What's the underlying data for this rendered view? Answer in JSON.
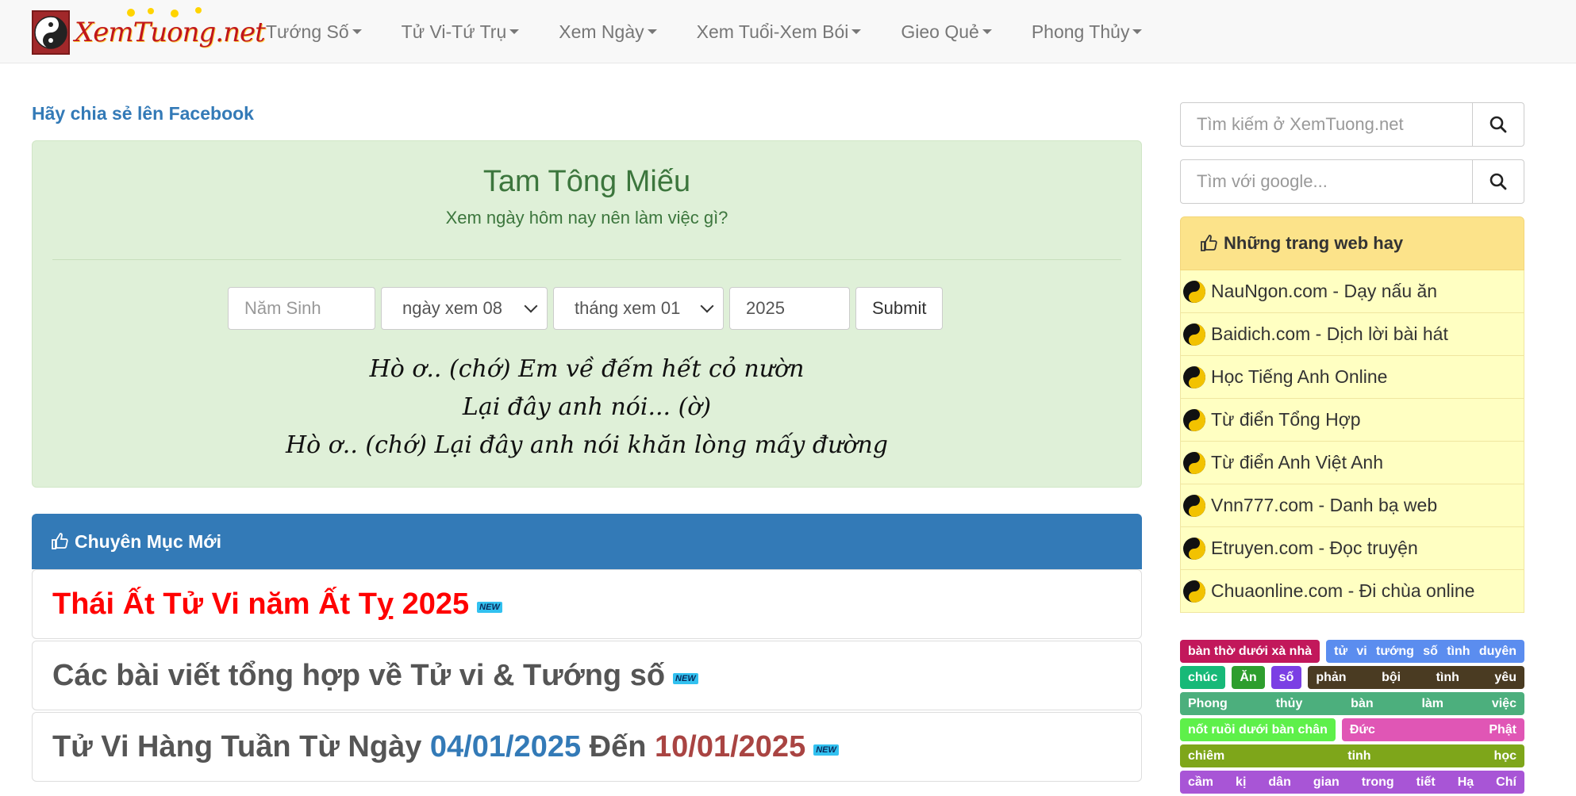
{
  "brand": {
    "logo_text": "XemTuong.net"
  },
  "nav": [
    {
      "label": "Tướng Số"
    },
    {
      "label": "Tử Vi-Tứ Trụ"
    },
    {
      "label": "Xem Ngày"
    },
    {
      "label": "Xem Tuổi-Xem Bói"
    },
    {
      "label": "Gieo Quẻ"
    },
    {
      "label": "Phong Thủy"
    }
  ],
  "share_link": "Hãy chia sẻ lên Facebook",
  "hero": {
    "title": "Tam Tông Miếu",
    "subtitle": "Xem ngày hôm nay nên làm việc gì?",
    "form": {
      "birth_year_placeholder": "Năm Sinh",
      "day_select": "ngày xem 08",
      "month_select": "tháng xem 01",
      "year_value": "2025",
      "submit_label": "Submit"
    },
    "poem": [
      "Hò ơ.. (chớ) Em về đếm hết cỏ nườn",
      "Lại đây anh nói... (ờ)",
      "Hò ơ.. (chớ) Lại đây anh nói khăn lòng mấy đường"
    ]
  },
  "new_section": {
    "header": "Chuyên Mục Mới",
    "badge": "NEW",
    "items": [
      {
        "text": "Thái Ất Tử Vi năm Ất Tỵ 2025"
      },
      {
        "text": "Các bài viết tổng hợp về Tử vi & Tướng số"
      },
      {
        "prefix": "Tử Vi Hàng Tuần Từ Ngày",
        "date1": "04/01/2025",
        "mid": "Đến",
        "date2": "10/01/2025"
      }
    ]
  },
  "sidebar": {
    "search_placeholder": "Tìm kiếm ở XemTuong.net",
    "google_placeholder": "Tìm với google...",
    "links_header": "Những trang web hay",
    "links": [
      "NauNgon.com - Dạy nấu ăn",
      "Baidich.com - Dịch lời bài hát",
      "Học Tiếng Anh Online",
      "Từ điển Tổng Hợp",
      "Từ điển Anh Việt Anh",
      "Vnn777.com - Danh bạ web",
      "Etruyen.com - Đọc truyện",
      "Chuaonline.com - Đi chùa online"
    ],
    "tags": [
      [
        {
          "text": "bàn thờ dưới xà nhà",
          "color": "#c2185b"
        },
        {
          "text": "tử vi tướng số tình duyên",
          "color": "#5b8def"
        }
      ],
      [
        {
          "text": "chúc",
          "color": "#17b978"
        },
        {
          "text": "Ăn",
          "color": "#2e9e2e"
        },
        {
          "text": "số",
          "color": "#7b3fe4"
        },
        {
          "text": "phản bội tình yêu",
          "color": "#4a3b22"
        }
      ],
      [
        {
          "text": "Phong thủy bàn làm việc",
          "color": "#4caf7d"
        }
      ],
      [
        {
          "text": "nốt ruồi dưới bàn chân",
          "color": "#5ef04a"
        },
        {
          "text": "Đức Phật",
          "color": "#e056b5"
        }
      ],
      [
        {
          "text": "chiêm tinh học",
          "color": "#7ea61a"
        }
      ],
      [
        {
          "text": "cầm kị dân gian trong tiết Hạ Chí",
          "color": "#a855d6"
        }
      ]
    ]
  }
}
